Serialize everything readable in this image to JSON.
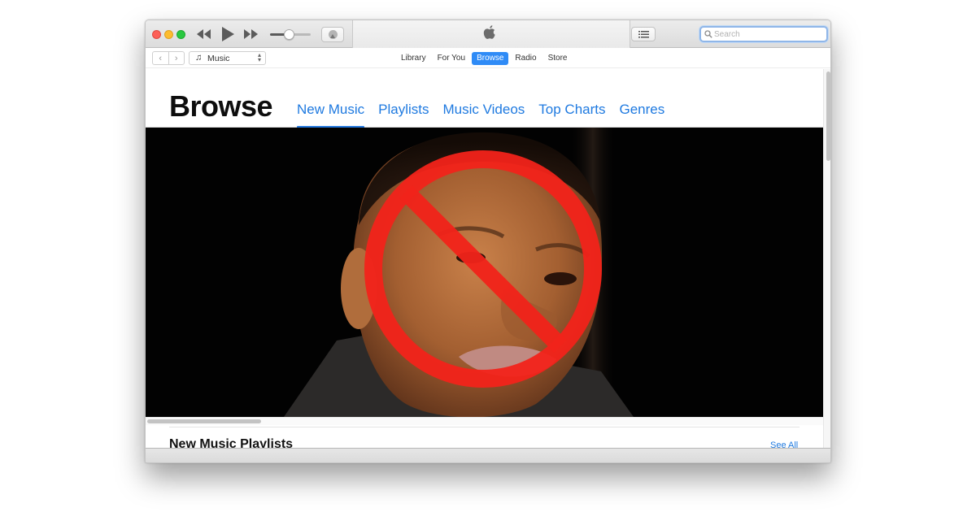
{
  "window": {
    "player": {
      "controls": [
        "rewind",
        "play",
        "fast-forward"
      ],
      "volume_level": 0.45,
      "airplay_icon": "airplay-icon",
      "logo_icon": "apple-logo-icon",
      "up_next_icon": "list-icon"
    },
    "search": {
      "placeholder": "Search",
      "value": "",
      "icon": "magnifier-icon"
    },
    "navbar": {
      "back_glyph": "‹",
      "forward_glyph": "›",
      "media_select": {
        "icon_glyph": "♫",
        "selected": "Music",
        "updown_glyph": "⌃⌄"
      },
      "tabs": [
        {
          "label": "Library",
          "active": false
        },
        {
          "label": "For You",
          "active": false
        },
        {
          "label": "Browse",
          "active": true
        },
        {
          "label": "Radio",
          "active": false
        },
        {
          "label": "Store",
          "active": false
        }
      ]
    },
    "browse": {
      "title": "Browse",
      "tabs": [
        {
          "label": "New Music",
          "active": true
        },
        {
          "label": "Playlists",
          "active": false
        },
        {
          "label": "Music Videos",
          "active": false
        },
        {
          "label": "Top Charts",
          "active": false
        },
        {
          "label": "Genres",
          "active": false
        }
      ]
    },
    "hero": {
      "description": "Portrait photo of a man on black background overlaid with a red prohibition sign",
      "overlay_icon": "prohibition-icon",
      "overlay_color": "#f2231a"
    },
    "section": {
      "title": "New Music Playlists",
      "see_all_label": "See All"
    }
  },
  "colors": {
    "accent": "#2f8bf6",
    "link": "#1f7ae0",
    "traffic_close": "#fc5f57",
    "traffic_minimize": "#fdbc2e",
    "traffic_maximize": "#29c840"
  }
}
